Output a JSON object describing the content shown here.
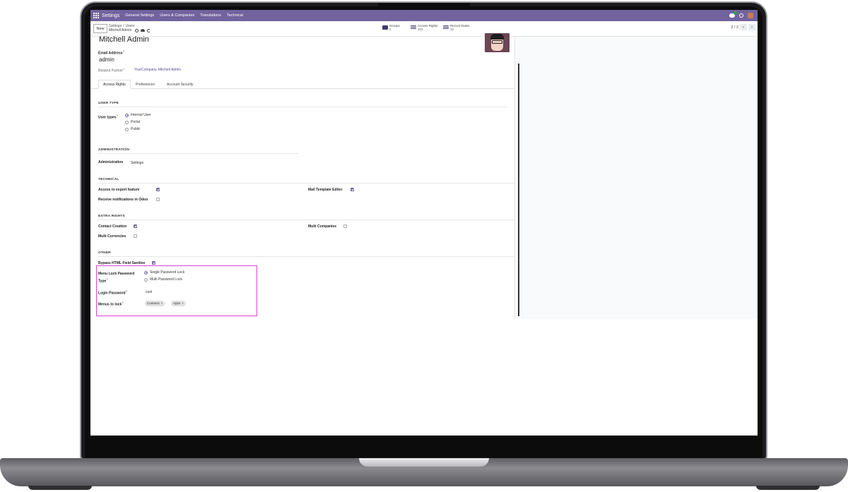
{
  "navbar": {
    "app_title": "Settings",
    "menu": [
      "General Settings",
      "Users & Companies",
      "Translations",
      "Technical"
    ]
  },
  "control_panel": {
    "new_label": "New",
    "breadcrumb_parent_1": "Settings",
    "breadcrumb_parent_2": "Users",
    "breadcrumb_current": "Mitchell Admin",
    "smart_buttons": [
      {
        "label": "Groups",
        "count": "6"
      },
      {
        "label": "Access Rights",
        "count": "203"
      },
      {
        "label": "Record Rules",
        "count": "33"
      }
    ],
    "pager": "2 / 2"
  },
  "user": {
    "name": "Mitchell Admin",
    "email_label": "Email Address",
    "email": "admin",
    "partner_label": "Related Partner",
    "partner": "YourCompany, Mitchell Admin"
  },
  "tabs": [
    "Access Rights",
    "Preferences",
    "Account Security"
  ],
  "user_type": {
    "section": "USER TYPE",
    "label": "User types",
    "options": [
      "Internal User",
      "Portal",
      "Public"
    ],
    "selected": "Internal User"
  },
  "administration": {
    "section": "ADMINISTRATION",
    "label": "Administration",
    "value": "Settings"
  },
  "technical": {
    "section": "TECHNICAL",
    "export_label": "Access to export feature",
    "notifications_label": "Receive notifications in Odoo",
    "mail_template_label": "Mail Template Editor"
  },
  "extra_rights": {
    "section": "EXTRA RIGHTS",
    "contact_creation_label": "Contact Creation",
    "multi_currencies_label": "Multi Currencies",
    "multi_companies_label": "Multi Companies"
  },
  "other": {
    "section": "OTHER",
    "bypass_label": "Bypass HTML Field Sanitize",
    "menu_lock_label_1": "Menu Lock Password",
    "menu_lock_label_2": "Type",
    "menu_lock_options": [
      "Single Password Lock",
      "Multi Password Lock"
    ],
    "menu_lock_selected": "Single Password Lock",
    "login_password_label": "Login Password",
    "login_password_value": "cool",
    "menus_to_lock_label": "Menus to lock",
    "menus_to_lock_tags": [
      "Contacts",
      "Apps"
    ]
  },
  "colors": {
    "navbar": "#71639e",
    "accent": "#71639e",
    "highlight_border": "#e040d8"
  }
}
